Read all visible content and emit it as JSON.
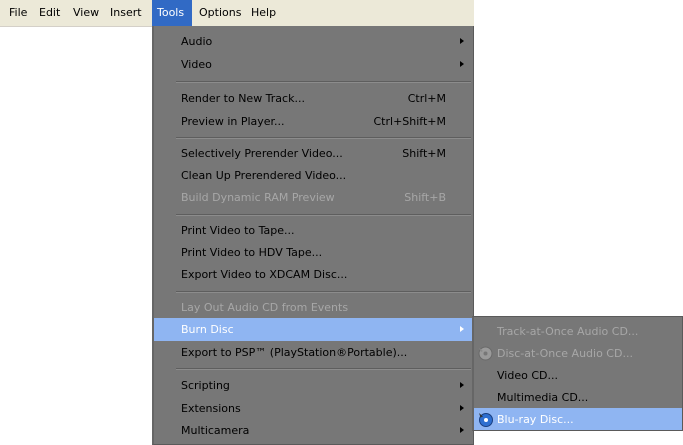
{
  "menubar": {
    "items": [
      {
        "label": "File"
      },
      {
        "label": "Edit"
      },
      {
        "label": "View"
      },
      {
        "label": "Insert"
      },
      {
        "label": "Tools",
        "active": true
      },
      {
        "label": "Options"
      },
      {
        "label": "Help"
      }
    ]
  },
  "tools_menu": {
    "audio": {
      "label": "Audio"
    },
    "video": {
      "label": "Video"
    },
    "render_new_track": {
      "label": "Render to New Track...",
      "shortcut": "Ctrl+M"
    },
    "preview_player": {
      "label": "Preview in Player...",
      "shortcut": "Ctrl+Shift+M"
    },
    "selectively_prerender": {
      "label": "Selectively Prerender Video...",
      "shortcut": "Shift+M"
    },
    "clean_up_prerendered": {
      "label": "Clean Up Prerendered Video..."
    },
    "build_ram_preview": {
      "label": "Build Dynamic RAM Preview",
      "shortcut": "Shift+B",
      "disabled": true
    },
    "print_tape": {
      "label": "Print Video to Tape..."
    },
    "print_hdv": {
      "label": "Print Video to HDV Tape..."
    },
    "export_xdcam": {
      "label": "Export Video to XDCAM Disc..."
    },
    "layout_audio_cd": {
      "label": "Lay Out Audio CD from Events",
      "disabled": true
    },
    "burn_disc": {
      "label": "Burn Disc",
      "highlighted": true
    },
    "export_psp": {
      "label": "Export to PSP™ (PlayStation®Portable)..."
    },
    "scripting": {
      "label": "Scripting"
    },
    "extensions": {
      "label": "Extensions"
    },
    "multicamera": {
      "label": "Multicamera"
    }
  },
  "burn_submenu": {
    "track_at_once": {
      "label": "Track-at-Once Audio CD...",
      "disabled": true
    },
    "disc_at_once": {
      "label": "Disc-at-Once Audio CD...",
      "disabled": true,
      "icon": "disc-burn-icon"
    },
    "video_cd": {
      "label": "Video CD..."
    },
    "multimedia_cd": {
      "label": "Multimedia CD..."
    },
    "bluray": {
      "label": "Blu-ray Disc...",
      "highlighted": true,
      "icon": "bluray-disc-icon"
    }
  },
  "colors": {
    "menubar_bg": "#ece9d8",
    "active_menu_bg": "#316ac5",
    "menu_bg": "#777777",
    "highlight_bg": "#8fb5f2",
    "disabled_text": "#a7a7a7"
  }
}
